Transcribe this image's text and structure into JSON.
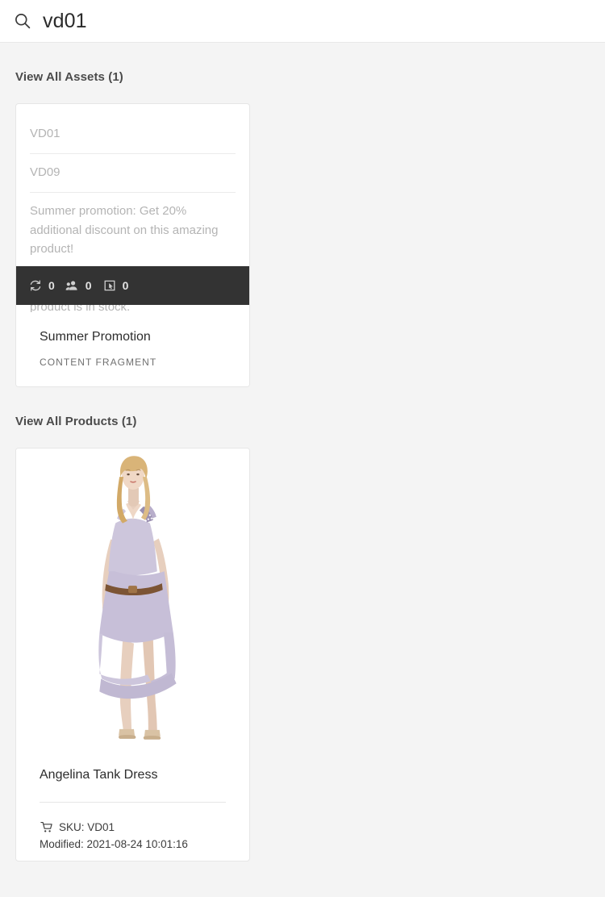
{
  "search": {
    "icon": "search-icon",
    "value": "vd01",
    "placeholder": "Search"
  },
  "assets_section": {
    "title": "View All Assets (1)",
    "card": {
      "fragment_lines": [
        "VD01",
        "VD09",
        "Summer promotion: Get 20% additional discount on this amazing product!",
        "This promotion is only valid while product is in stock."
      ],
      "stats": [
        {
          "icon": "sync-icon",
          "count": "0"
        },
        {
          "icon": "users-icon",
          "count": "0"
        },
        {
          "icon": "annotate-icon",
          "count": "0"
        }
      ],
      "title": "Summer Promotion",
      "kicker": "CONTENT FRAGMENT"
    }
  },
  "products_section": {
    "title": "View All Products (1)",
    "card": {
      "image_alt": "Angelina Tank Dress product photo",
      "name": "Angelina Tank Dress",
      "sku_icon": "cart-icon",
      "sku": "SKU: VD01",
      "modified": "Modified: 2021-08-24 10:01:16"
    }
  },
  "colors": {
    "page_background": "#f4f4f4",
    "card_background": "#ffffff",
    "overlay_bar": "#333333",
    "muted_text": "#b4b4b4",
    "heading_text": "#4b4b4b",
    "dress": "#cdc6dc"
  }
}
